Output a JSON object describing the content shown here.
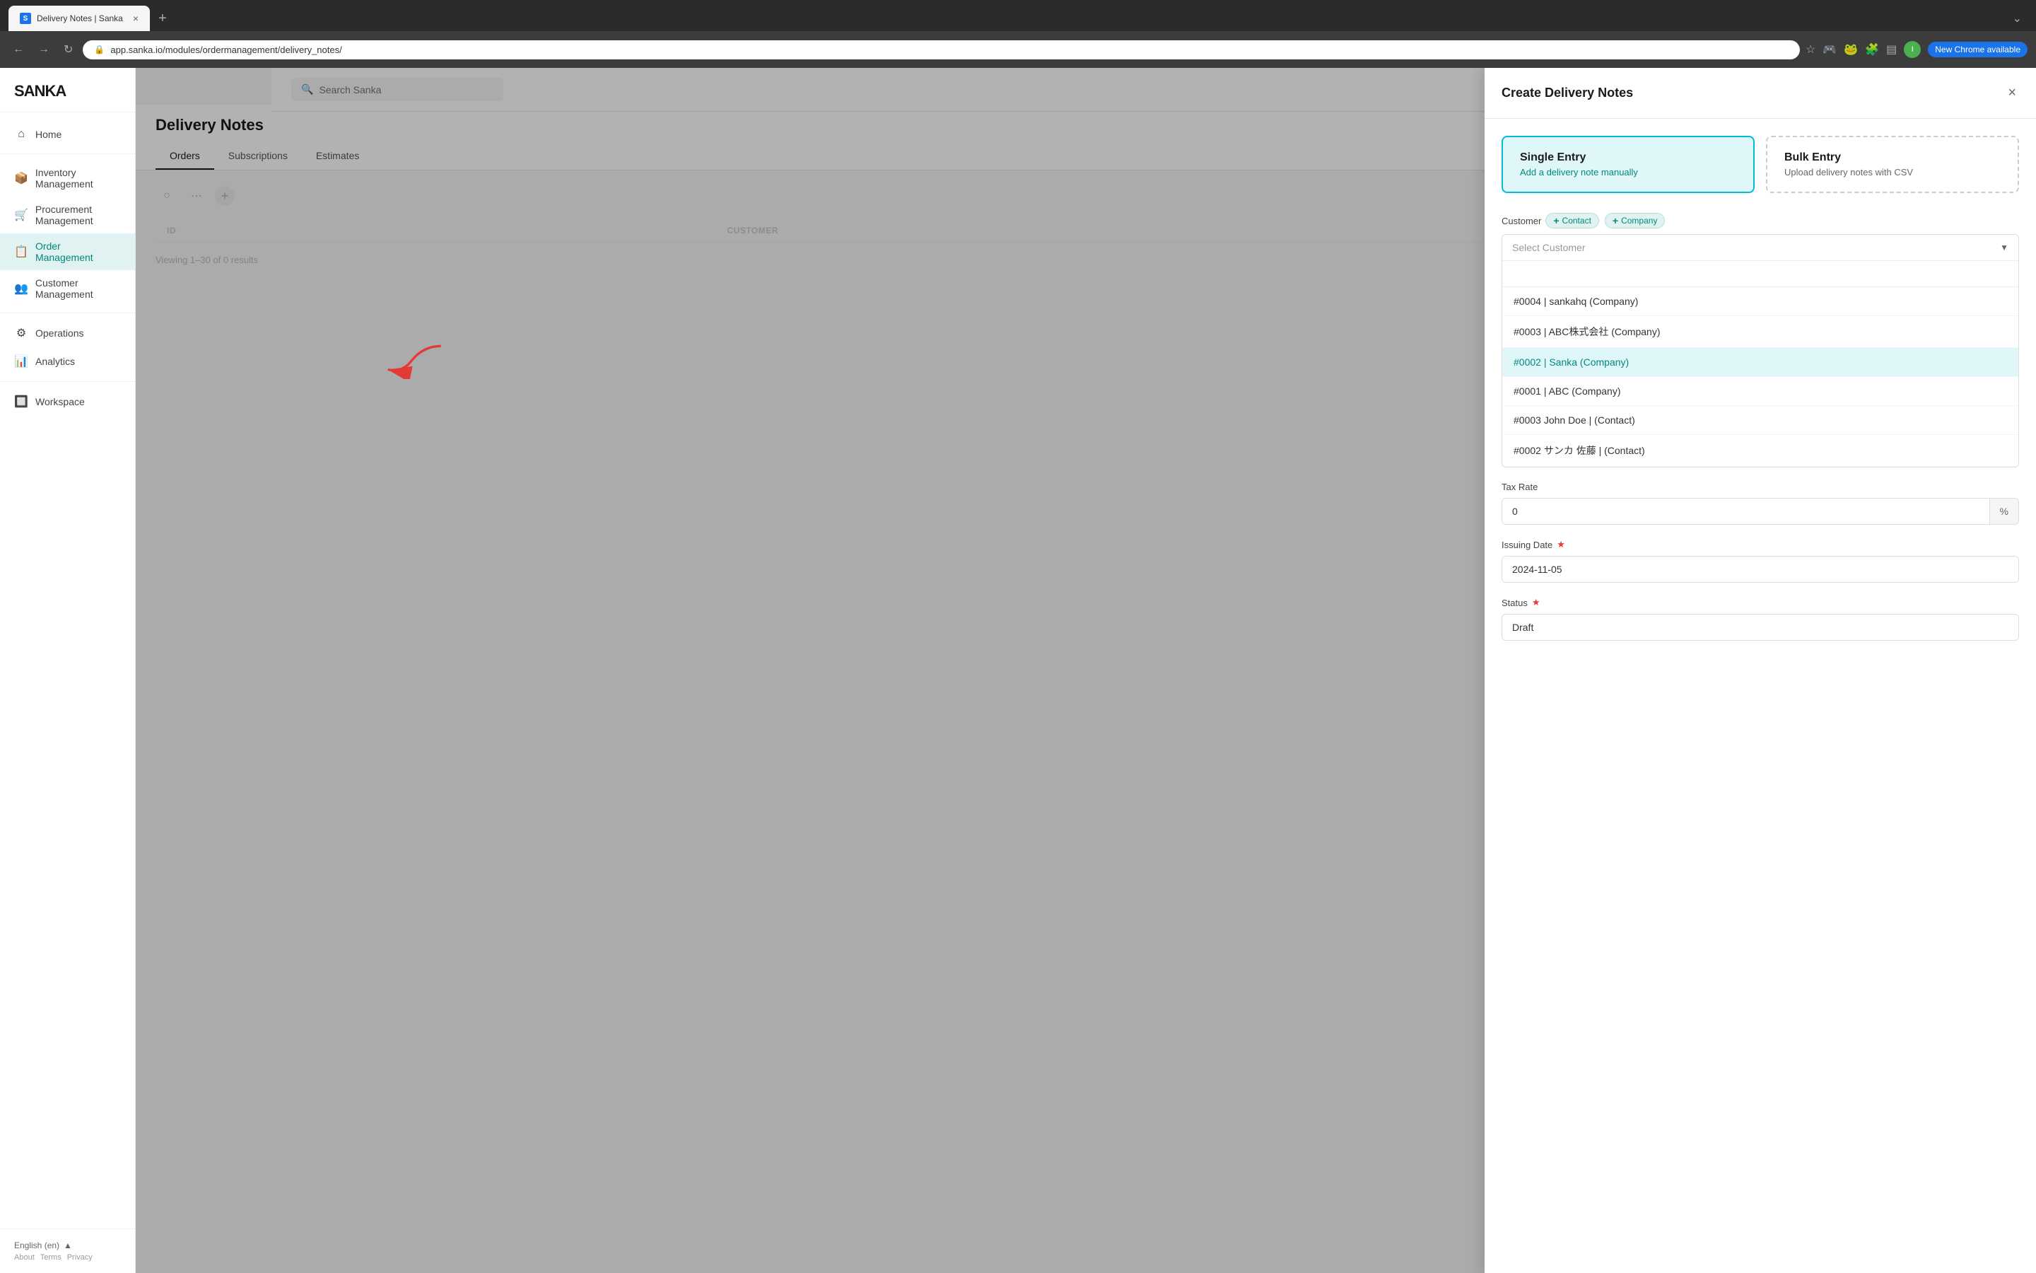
{
  "browser": {
    "tab_title": "Delivery Notes | Sanka",
    "tab_favicon": "S",
    "url": "app.sanka.io/modules/ordermanagement/delivery_notes/",
    "new_chrome_label": "New Chrome available"
  },
  "sidebar": {
    "logo": "SANKA",
    "search_placeholder": "Search Sanka",
    "nav_items": [
      {
        "id": "home",
        "label": "Home",
        "icon": "⌂"
      },
      {
        "id": "inventory",
        "label": "Inventory Management",
        "icon": "📦"
      },
      {
        "id": "procurement",
        "label": "Procurement Management",
        "icon": "🛒"
      },
      {
        "id": "order",
        "label": "Order Management",
        "icon": "📋",
        "active": true
      },
      {
        "id": "customer",
        "label": "Customer Management",
        "icon": "👥"
      },
      {
        "id": "operations",
        "label": "Operations",
        "icon": "⚙"
      },
      {
        "id": "analytics",
        "label": "Analytics",
        "icon": "📊"
      },
      {
        "id": "workspace",
        "label": "Workspace",
        "icon": "🔲"
      }
    ],
    "footer": {
      "language": "English (en)",
      "links": [
        "About",
        "Terms",
        "Privacy"
      ]
    }
  },
  "page": {
    "title": "Delivery Notes",
    "tabs": [
      {
        "id": "orders",
        "label": "Orders"
      },
      {
        "id": "subscriptions",
        "label": "Subscriptions"
      },
      {
        "id": "estimates",
        "label": "Estimates"
      }
    ],
    "table": {
      "columns": [
        "ID",
        "CUSTOMER"
      ],
      "viewing_text": "Viewing 1–30 of 0 results"
    }
  },
  "modal": {
    "title": "Create Delivery Notes",
    "close_label": "×",
    "entry_types": [
      {
        "id": "single",
        "title": "Single Entry",
        "subtitle": "Add a delivery note manually",
        "active": true
      },
      {
        "id": "bulk",
        "title": "Bulk Entry",
        "subtitle": "Upload delivery notes with CSV",
        "active": false
      }
    ],
    "form": {
      "customer_label": "Customer",
      "contact_badge": "Contact",
      "company_badge": "Company",
      "select_placeholder": "Select Customer",
      "dropdown_items": [
        {
          "id": "0004",
          "label": "#0004 | sankahq (Company)",
          "highlighted": false
        },
        {
          "id": "0003c",
          "label": "#0003 | ABC株式会社 (Company)",
          "highlighted": false
        },
        {
          "id": "0002",
          "label": "#0002 | Sanka (Company)",
          "highlighted": true
        },
        {
          "id": "0001",
          "label": "#0001 | ABC (Company)",
          "highlighted": false
        },
        {
          "id": "0003j",
          "label": "#0003 John Doe | (Contact)",
          "highlighted": false
        },
        {
          "id": "0002s",
          "label": "#0002 サンカ 佐藤 | (Contact)",
          "highlighted": false
        }
      ],
      "tax_rate_label": "Tax Rate",
      "tax_rate_value": "0",
      "tax_rate_suffix": "%",
      "issuing_date_label": "Issuing Date",
      "issuing_date_value": "2024-11-05",
      "status_label": "Status",
      "status_value": "Draft"
    }
  }
}
